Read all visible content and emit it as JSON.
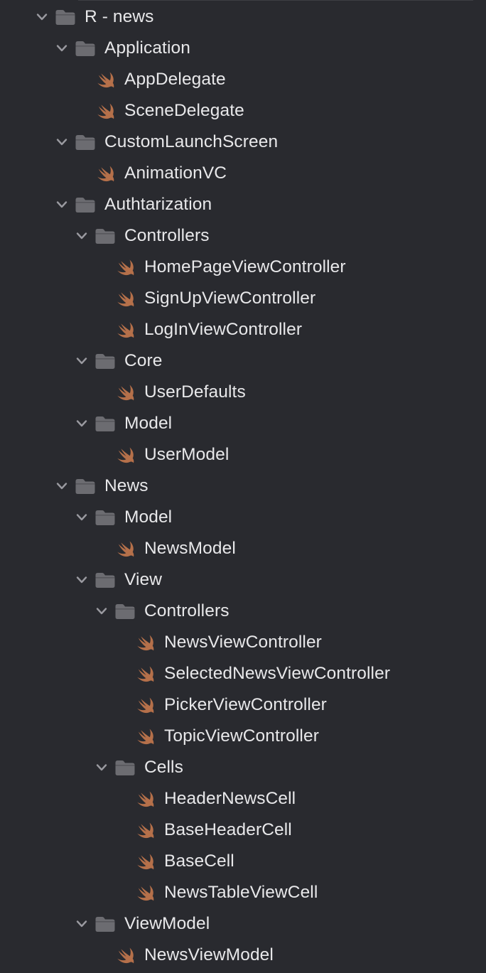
{
  "project_navigator": {
    "items": [
      {
        "label": "R - news",
        "kind": "folder",
        "depth": 0
      },
      {
        "label": "Application",
        "kind": "folder",
        "depth": 1
      },
      {
        "label": "AppDelegate",
        "kind": "swift-file",
        "depth": 2
      },
      {
        "label": "SceneDelegate",
        "kind": "swift-file",
        "depth": 2
      },
      {
        "label": "CustomLaunchScreen",
        "kind": "folder",
        "depth": 1
      },
      {
        "label": "AnimationVC",
        "kind": "swift-file",
        "depth": 2
      },
      {
        "label": "Authtarization",
        "kind": "folder",
        "depth": 1
      },
      {
        "label": "Controllers",
        "kind": "folder",
        "depth": 2
      },
      {
        "label": "HomePageViewController",
        "kind": "swift-file",
        "depth": 3
      },
      {
        "label": "SignUpViewController",
        "kind": "swift-file",
        "depth": 3
      },
      {
        "label": "LogInViewController",
        "kind": "swift-file",
        "depth": 3
      },
      {
        "label": "Core",
        "kind": "folder",
        "depth": 2
      },
      {
        "label": "UserDefaults",
        "kind": "swift-file",
        "depth": 3
      },
      {
        "label": "Model",
        "kind": "folder",
        "depth": 2
      },
      {
        "label": "UserModel",
        "kind": "swift-file",
        "depth": 3
      },
      {
        "label": "News",
        "kind": "folder",
        "depth": 1
      },
      {
        "label": "Model",
        "kind": "folder",
        "depth": 2
      },
      {
        "label": "NewsModel",
        "kind": "swift-file",
        "depth": 3
      },
      {
        "label": "View",
        "kind": "folder",
        "depth": 2
      },
      {
        "label": "Controllers",
        "kind": "folder",
        "depth": 3
      },
      {
        "label": "NewsViewController",
        "kind": "swift-file",
        "depth": 4
      },
      {
        "label": "SelectedNewsViewController",
        "kind": "swift-file",
        "depth": 4
      },
      {
        "label": "PickerViewController",
        "kind": "swift-file",
        "depth": 4
      },
      {
        "label": "TopicViewController",
        "kind": "swift-file",
        "depth": 4
      },
      {
        "label": "Cells",
        "kind": "folder",
        "depth": 3
      },
      {
        "label": "HeaderNewsCell",
        "kind": "swift-file",
        "depth": 4
      },
      {
        "label": "BaseHeaderCell",
        "kind": "swift-file",
        "depth": 4
      },
      {
        "label": "BaseCell",
        "kind": "swift-file",
        "depth": 4
      },
      {
        "label": "NewsTableViewCell",
        "kind": "swift-file",
        "depth": 4
      },
      {
        "label": "ViewModel",
        "kind": "folder",
        "depth": 2
      },
      {
        "label": "NewsViewModel",
        "kind": "swift-file",
        "depth": 3
      }
    ],
    "icons": {
      "folder": "folder-icon",
      "swift_file": "swift-file-icon",
      "disclosure": "chevron-down-icon"
    },
    "colors": {
      "background": "#292a2f",
      "text": "#e8e8ea",
      "folder": "#6c6c71",
      "swift": "#b5704a",
      "chevron": "#9a9aa0"
    }
  }
}
